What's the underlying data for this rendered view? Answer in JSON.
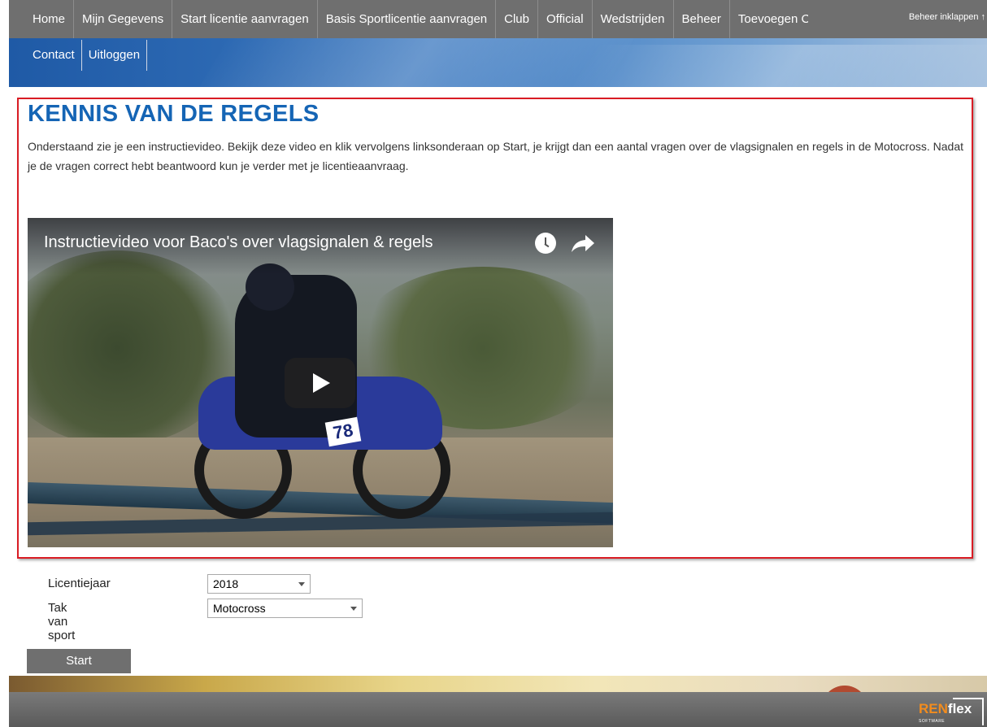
{
  "nav": {
    "top_items": [
      "Home",
      "Mijn Gegevens",
      "Start licentie aanvragen",
      "Basis Sportlicentie aanvragen",
      "Club",
      "Official",
      "Wedstrijden",
      "Beheer",
      "Toevoegen Clubgebruiker"
    ],
    "overflow_text": "Beheer inklappen ↑",
    "bottom_items": [
      "Contact",
      "Uitloggen"
    ]
  },
  "content": {
    "title": "KENNIS VAN DE REGELS",
    "intro": "Onderstaand zie je een instructievideo. Bekijk deze video en klik vervolgens linksonderaan op Start, je krijgt dan een aantal vragen over de vlagsignalen en regels in de Motocross. Nadat je de vragen correct hebt beantwoord kun je verder met je licentieaanvraag."
  },
  "video": {
    "title": "Instructievideo voor Baco's over vlagsignalen & regels",
    "rider_number": "78",
    "icons": [
      "watch-later-icon",
      "share-icon",
      "play-icon"
    ]
  },
  "form": {
    "licentiejaar_label": "Licentiejaar",
    "licentiejaar_value": "2018",
    "tak_label": "Tak van sport",
    "tak_value": "Motocross"
  },
  "start_label": "Start",
  "footer": {
    "logo_ren": "REN",
    "logo_flex": "flex",
    "logo_sub": "SOFTWARE"
  },
  "colors": {
    "nav_bg": "#6f6f6f",
    "title_blue": "#1565b5",
    "highlight_red": "#d91c24",
    "logo_orange": "#f28c1e"
  }
}
